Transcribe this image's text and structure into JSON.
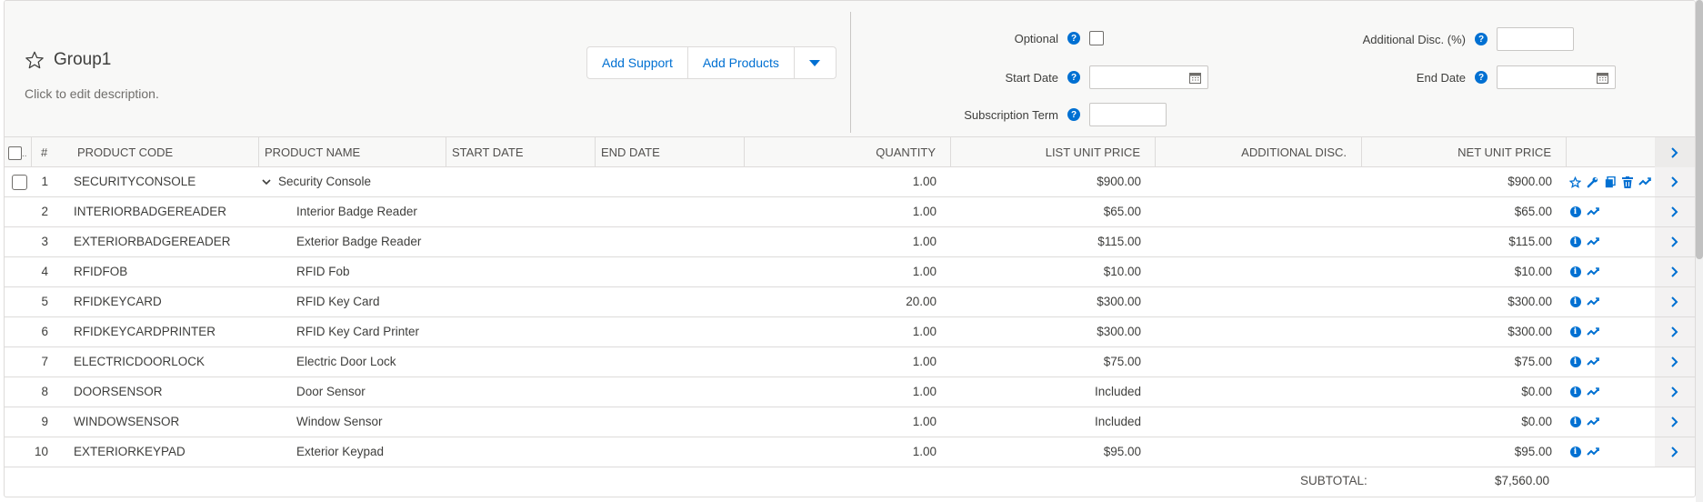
{
  "group": {
    "title": "Group1",
    "description": "Click to edit description."
  },
  "buttons": {
    "add_support": "Add Support",
    "add_products": "Add Products"
  },
  "fields": {
    "optional": {
      "label": "Optional",
      "checked": false
    },
    "start_date": {
      "label": "Start Date",
      "value": ""
    },
    "subscription_term": {
      "label": "Subscription Term",
      "value": ""
    },
    "additional_disc": {
      "label": "Additional Disc. (%)",
      "value": ""
    },
    "end_date": {
      "label": "End Date",
      "value": ""
    }
  },
  "table": {
    "columns": {
      "select": "..",
      "num": "#",
      "product_code": "PRODUCT CODE",
      "product_name": "PRODUCT NAME",
      "start_date": "START DATE",
      "end_date": "END DATE",
      "quantity": "QUANTITY",
      "list_unit_price": "LIST UNIT PRICE",
      "additional_disc": "ADDITIONAL DISC.",
      "net_unit_price": "NET UNIT PRICE"
    },
    "rows": [
      {
        "num": "1",
        "code": "SECURITYCONSOLE",
        "name": "Security Console",
        "qty": "1.00",
        "list": "$900.00",
        "net": "$900.00",
        "bundle": true
      },
      {
        "num": "2",
        "code": "INTERIORBADGEREADER",
        "name": "Interior Badge Reader",
        "qty": "1.00",
        "list": "$65.00",
        "net": "$65.00"
      },
      {
        "num": "3",
        "code": "EXTERIORBADGEREADER",
        "name": "Exterior Badge Reader",
        "qty": "1.00",
        "list": "$115.00",
        "net": "$115.00"
      },
      {
        "num": "4",
        "code": "RFIDFOB",
        "name": "RFID Fob",
        "qty": "1.00",
        "list": "$10.00",
        "net": "$10.00"
      },
      {
        "num": "5",
        "code": "RFIDKEYCARD",
        "name": "RFID Key Card",
        "qty": "20.00",
        "list": "$300.00",
        "net": "$300.00"
      },
      {
        "num": "6",
        "code": "RFIDKEYCARDPRINTER",
        "name": "RFID Key Card Printer",
        "qty": "1.00",
        "list": "$300.00",
        "net": "$300.00"
      },
      {
        "num": "7",
        "code": "ELECTRICDOORLOCK",
        "name": "Electric Door Lock",
        "qty": "1.00",
        "list": "$75.00",
        "net": "$75.00"
      },
      {
        "num": "8",
        "code": "DOORSENSOR",
        "name": "Door Sensor",
        "qty": "1.00",
        "list": "Included",
        "net": "$0.00"
      },
      {
        "num": "9",
        "code": "WINDOWSENSOR",
        "name": "Window Sensor",
        "qty": "1.00",
        "list": "Included",
        "net": "$0.00"
      },
      {
        "num": "10",
        "code": "EXTERIORKEYPAD",
        "name": "Exterior Keypad",
        "qty": "1.00",
        "list": "$95.00",
        "net": "$95.00"
      }
    ]
  },
  "subtotal": {
    "label": "SUBTOTAL:",
    "value": "$7,560.00"
  },
  "colors": {
    "accent": "#0070d2",
    "border": "#dddbda",
    "header_bg": "#f8f8f7"
  }
}
